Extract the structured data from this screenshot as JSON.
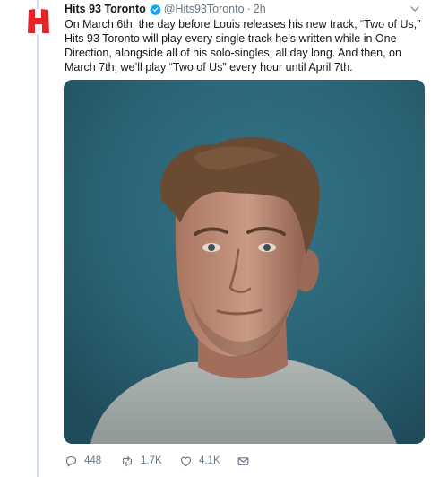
{
  "tweet": {
    "author_name": "Hits 93 Toronto",
    "handle": "@Hits93Toronto",
    "separator": "·",
    "time": "2h",
    "text": "On March 6th, the day before Louis releases his new track, “Two of Us,” Hits 93 Toronto will play every single track he’s written while in One Direction, alongside all of his solo-singles, all day long.  And then, on March 7th, we’ll play “Two of Us” every hour until April 7th."
  },
  "actions": {
    "replies": "448",
    "retweets": "1.7K",
    "likes": "4.1K"
  },
  "icons": {
    "logo": "h-logo-icon",
    "verified": "verified-badge-icon",
    "more": "chevron-down-icon",
    "reply": "reply-icon",
    "retweet": "retweet-icon",
    "like": "heart-icon",
    "dm": "envelope-icon"
  },
  "colors": {
    "brand_red": "#e3242b",
    "verified_blue": "#1da1f2",
    "text": "#14171a",
    "muted": "#657786",
    "photo_bg": "#2a6274"
  }
}
